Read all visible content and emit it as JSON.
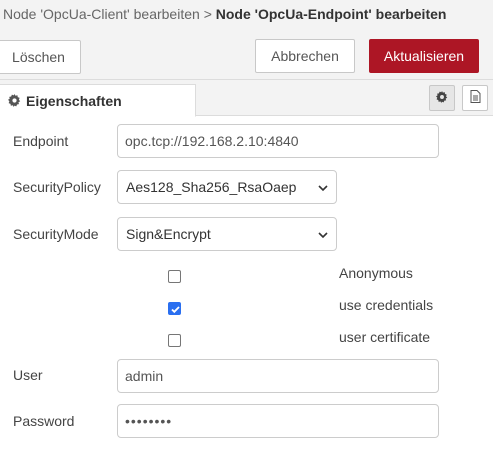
{
  "breadcrumb": {
    "parent": "Node 'OpcUa-Client' bearbeiten",
    "separator": ">",
    "current": "Node 'OpcUa-Endpoint' bearbeiten"
  },
  "toolbar": {
    "delete_label": "Löschen",
    "cancel_label": "Abbrechen",
    "update_label": "Aktualisieren",
    "update_color": "#ad1625"
  },
  "tabs": [
    {
      "label": "Eigenschaften",
      "icon": "gear-icon",
      "active": true
    }
  ],
  "side_icons": [
    {
      "icon": "gear-icon",
      "active": true
    },
    {
      "icon": "document-icon",
      "active": false
    }
  ],
  "form": {
    "endpoint": {
      "label": "Endpoint",
      "value": "opc.tcp://192.168.2.10:4840"
    },
    "security_policy": {
      "label": "SecurityPolicy",
      "value": "Aes128_Sha256_RsaOaep"
    },
    "security_mode": {
      "label": "SecurityMode",
      "value": "Sign&Encrypt"
    },
    "options": [
      {
        "label": "Anonymous",
        "checked": false
      },
      {
        "label": "use credentials",
        "checked": true
      },
      {
        "label": "user certificate",
        "checked": false
      }
    ],
    "user": {
      "label": "User",
      "value": "admin"
    },
    "password": {
      "label": "Password",
      "value": "••••••••"
    }
  },
  "colors": {
    "accent": "#ad1625",
    "checkbox_checked": "#2a6ff0"
  }
}
